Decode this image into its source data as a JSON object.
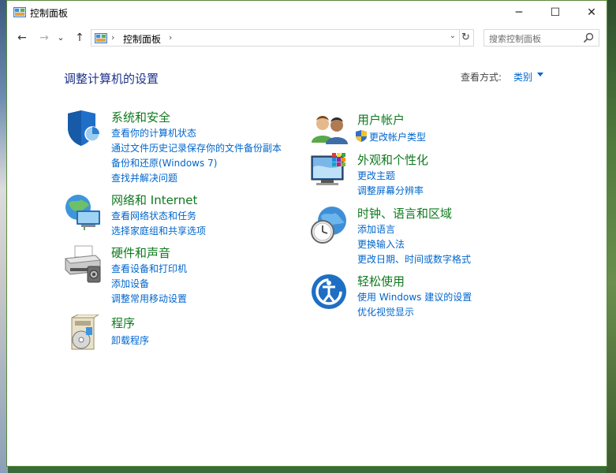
{
  "window": {
    "title": "控制面板",
    "minimize": "─",
    "maximize": "☐",
    "close": "✕"
  },
  "nav": {
    "back": "←",
    "forward": "→",
    "recent": "⌄",
    "up": "↑",
    "address_crumb": "控制面板",
    "address_sep": "›",
    "address_sep_after": "›",
    "dropdown": "⌄",
    "refresh": "↻",
    "search_placeholder": "搜索控制面板"
  },
  "main": {
    "heading": "调整计算机的设置",
    "view_by_label": "查看方式:",
    "view_by_value": "类别"
  },
  "categories_left": [
    {
      "title": "系统和安全",
      "icon": "shield-icon",
      "links": [
        "查看你的计算机状态",
        "通过文件历史记录保存你的文件备份副本",
        "备份和还原(Windows 7)",
        "查找并解决问题"
      ]
    },
    {
      "title": "网络和 Internet",
      "icon": "network-icon",
      "links": [
        "查看网络状态和任务",
        "选择家庭组和共享选项"
      ]
    },
    {
      "title": "硬件和声音",
      "icon": "printer-icon",
      "links": [
        "查看设备和打印机",
        "添加设备",
        "调整常用移动设置"
      ]
    },
    {
      "title": "程序",
      "icon": "programs-icon",
      "links": [
        "卸载程序"
      ]
    }
  ],
  "categories_right": [
    {
      "title": "用户帐户",
      "icon": "users-icon",
      "links": [
        "更改帐户类型"
      ]
    },
    {
      "title": "外观和个性化",
      "icon": "monitor-icon",
      "links": [
        "更改主题",
        "调整屏幕分辨率"
      ]
    },
    {
      "title": "时钟、语言和区域",
      "icon": "clock-globe-icon",
      "links": [
        "添加语言",
        "更换输入法",
        "更改日期、时间或数字格式"
      ]
    },
    {
      "title": "轻松使用",
      "icon": "ease-of-access-icon",
      "links": [
        "使用 Windows 建议的设置",
        "优化视觉显示"
      ]
    }
  ],
  "colors": {
    "category_title": "#0f7a1e",
    "link": "#0066cc",
    "heading": "#1e3287"
  }
}
